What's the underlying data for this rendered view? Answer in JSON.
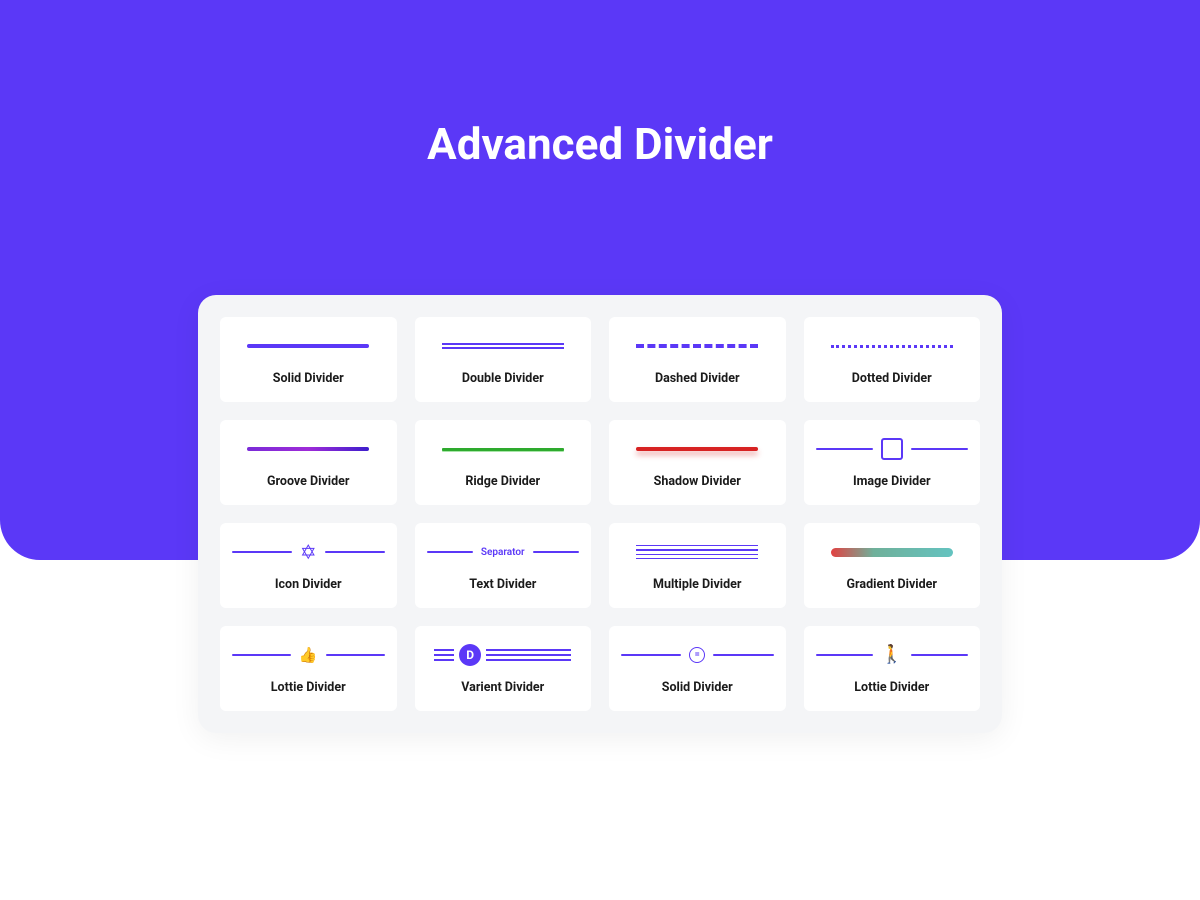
{
  "page": {
    "title": "Advanced Divider"
  },
  "tiles": [
    {
      "label": "Solid Divider"
    },
    {
      "label": "Double Divider"
    },
    {
      "label": "Dashed Divider"
    },
    {
      "label": "Dotted Divider"
    },
    {
      "label": "Groove Divider"
    },
    {
      "label": "Ridge Divider"
    },
    {
      "label": "Shadow Divider"
    },
    {
      "label": "Image Divider"
    },
    {
      "label": "Icon Divider"
    },
    {
      "label": "Text Divider",
      "separator_text": "Separator"
    },
    {
      "label": "Multiple Divider"
    },
    {
      "label": "Gradient Divider"
    },
    {
      "label": "Lottie Divider"
    },
    {
      "label": "Varient Divider",
      "badge": "D"
    },
    {
      "label": "Solid Divider",
      "center_glyph": "="
    },
    {
      "label": "Lottie Divider"
    }
  ],
  "colors": {
    "primary": "#5B38F7",
    "gradient_start": "#e24141",
    "gradient_end": "#64c3c0",
    "ridge_green": "#2eaa2e",
    "shadow_red": "#d72222"
  }
}
